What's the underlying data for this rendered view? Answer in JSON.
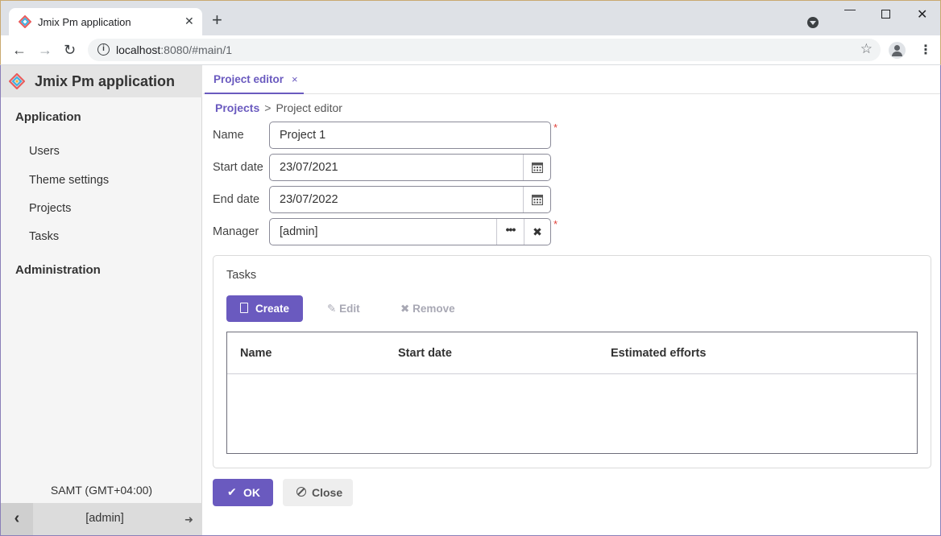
{
  "browser": {
    "tab_title": "Jmix Pm application",
    "tab_close": "✕",
    "new_tab": "+",
    "url_host": "localhost",
    "url_path": ":8080/#main/1"
  },
  "sidebar": {
    "app_title": "Jmix Pm application",
    "groups": [
      {
        "label": "Application",
        "items": [
          "Users",
          "Theme settings",
          "Projects",
          "Tasks"
        ]
      },
      {
        "label": "Administration",
        "items": []
      }
    ],
    "timezone": "SAMT (GMT+04:00)",
    "user": "[admin]"
  },
  "tab": {
    "label": "Project editor",
    "close": "×"
  },
  "breadcrumb": {
    "parent": "Projects",
    "separator": ">",
    "current": "Project editor"
  },
  "form": {
    "name_label": "Name",
    "name_value": "Project 1",
    "start_label": "Start date",
    "start_value": "23/07/2021",
    "end_label": "End date",
    "end_value": "23/07/2022",
    "manager_label": "Manager",
    "manager_value": "[admin]",
    "required_mark": "*"
  },
  "tasks": {
    "title": "Tasks",
    "create_label": "Create",
    "edit_label": "Edit",
    "remove_label": "Remove",
    "columns": [
      "Name",
      "Start date",
      "Estimated efforts"
    ],
    "rows": []
  },
  "actions": {
    "ok_label": "OK",
    "close_label": "Close"
  },
  "colors": {
    "accent": "#6a5abf",
    "required": "#e0413a"
  }
}
